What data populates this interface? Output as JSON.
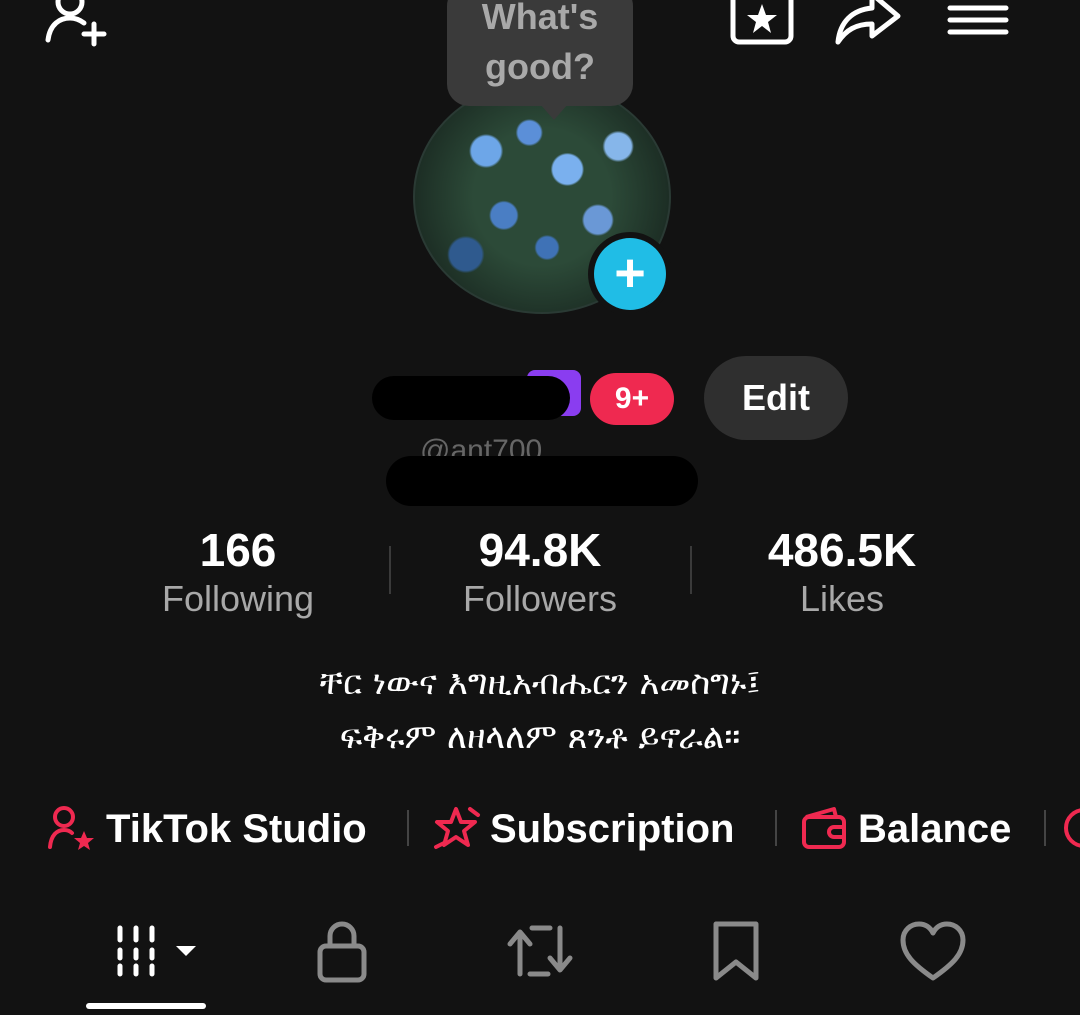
{
  "tooltip": {
    "text": "What's\ngood?"
  },
  "profile": {
    "handle_hint": "@ant700",
    "notification_badge": "9+",
    "edit_label": "Edit",
    "avatar_add_symbol": "+"
  },
  "stats": [
    {
      "value": "166",
      "label": "Following"
    },
    {
      "value": "94.8K",
      "label": "Followers"
    },
    {
      "value": "486.5K",
      "label": "Likes"
    }
  ],
  "bio": {
    "line1": "ቸር ነውና እግዚአብሔርን አመስግኑ፤",
    "line2": "ፍቅሩም ለዘላለም ጸንቶ ይኖራል።"
  },
  "quick_links": [
    {
      "label": "TikTok Studio",
      "icon": "person-star-icon"
    },
    {
      "label": "Subscription",
      "icon": "star-burst-icon"
    },
    {
      "label": "Balance",
      "icon": "wallet-icon"
    }
  ],
  "tabs": [
    {
      "name": "videos-grid",
      "icon": "grid-icon",
      "active": true
    },
    {
      "name": "private",
      "icon": "lock-icon",
      "active": false
    },
    {
      "name": "reposts",
      "icon": "repost-icon",
      "active": false
    },
    {
      "name": "favorites",
      "icon": "bookmark-icon",
      "active": false
    },
    {
      "name": "liked",
      "icon": "heart-icon",
      "active": false
    }
  ],
  "colors": {
    "background": "#121212",
    "accent_red": "#ef2950",
    "accent_cyan": "#20bde6",
    "badge_purple": "#8a3df0",
    "muted_text": "#a8a8a8"
  }
}
